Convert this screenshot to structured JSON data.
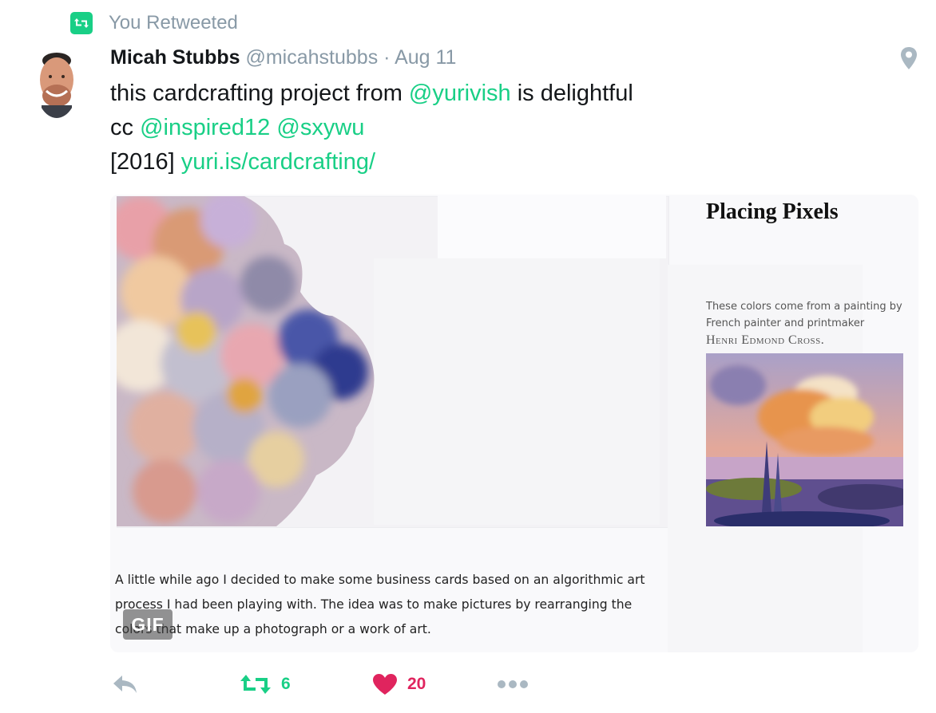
{
  "retweet_context": {
    "label": "You Retweeted",
    "icon": "retweet-icon"
  },
  "tweet": {
    "author": {
      "name": "Micah Stubbs",
      "handle": "@micahstubbs",
      "avatar_icon": "avatar-photo"
    },
    "separator": "·",
    "date": "Aug 11",
    "location_icon": "location-pin-icon",
    "text": {
      "line1_prefix": "this cardcrafting project from ",
      "line1_mention": "@yurivish",
      "line1_suffix": " is delightful",
      "line2_prefix": "cc ",
      "line2_mention1": "@inspired12",
      "line2_mention2": "@sxywu",
      "line3_prefix": "[2016] ",
      "line3_link": "yuri.is/cardcrafting/"
    },
    "media": {
      "title": "Placing Pixels",
      "desc_line1": "These colors come from a painting by",
      "desc_line2": "French painter and printmaker",
      "desc_artist": "Henri Edmond Cross.",
      "body_line1": "A little while ago I decided to make some business cards based on an algorithmic art",
      "body_line2": "process I had been playing with. The idea was to make pictures by rearranging the",
      "body_line3": "colors that make up a photograph or a work of art.",
      "badge": "GIF"
    },
    "actions": {
      "reply_icon": "reply-icon",
      "retweet_count": "6",
      "like_count": "20",
      "more_icon": "more-dots-icon"
    }
  },
  "colors": {
    "accent": "#19cf86",
    "like": "#e0245e",
    "muted": "#8899a6",
    "text": "#14171a"
  }
}
